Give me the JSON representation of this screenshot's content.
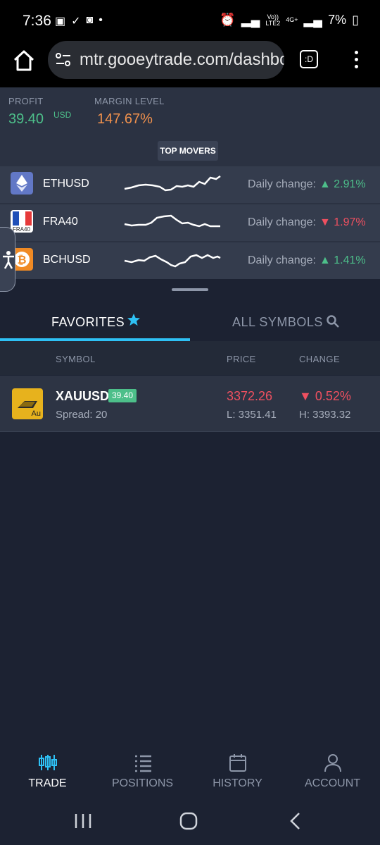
{
  "status_bar": {
    "time": "7:36",
    "net_top": "Vo))",
    "net_bottom": "LTE2",
    "data_type": "4G+",
    "battery": "7%"
  },
  "browser": {
    "url": "mtr.gooeytrade.com/dashbo",
    "tab_count_label": ":D"
  },
  "account": {
    "profit_label": "PROFIT",
    "profit_value": "39.40",
    "profit_currency": "USD",
    "margin_label": "MARGIN LEVEL",
    "margin_value": "147.67%",
    "top_movers_label": "TOP MOVERS"
  },
  "movers": [
    {
      "symbol": "ETHUSD",
      "daily_label": "Daily change:",
      "change": "2.91%",
      "direction": "up",
      "icon": "ethereum-icon"
    },
    {
      "symbol": "FRA40",
      "icon_caption": "FRA40",
      "daily_label": "Daily change:",
      "change": "1.97%",
      "direction": "down",
      "icon": "france-flag-icon"
    },
    {
      "symbol": "BCHUSD",
      "daily_label": "Daily change:",
      "change": "1.41%",
      "direction": "up",
      "icon": "bitcoin-icon"
    }
  ],
  "tabs": {
    "favorites": "FAVORITES",
    "all_symbols": "ALL SYMBOLS"
  },
  "table": {
    "headers": {
      "symbol": "SYMBOL",
      "price": "PRICE",
      "change": "CHANGE"
    },
    "rows": [
      {
        "symbol": "XAUUSD",
        "icon_caption": "Au",
        "badge": "39.40",
        "spread": "Spread: 20",
        "price": "3372.26",
        "low": "L: 3351.41",
        "change": "0.52%",
        "high": "H: 3393.32"
      }
    ]
  },
  "bottom_nav": [
    {
      "label": "TRADE",
      "icon": "candlestick-icon",
      "active": true
    },
    {
      "label": "POSITIONS",
      "icon": "list-icon",
      "active": false
    },
    {
      "label": "HISTORY",
      "icon": "calendar-icon",
      "active": false
    },
    {
      "label": "ACCOUNT",
      "icon": "user-icon",
      "active": false
    }
  ],
  "colors": {
    "background": "#1c2232",
    "panel": "#2b3242",
    "up": "#4dbf8a",
    "down": "#ef5060",
    "accent": "#2ec1f5",
    "margin": "#f0914d"
  }
}
